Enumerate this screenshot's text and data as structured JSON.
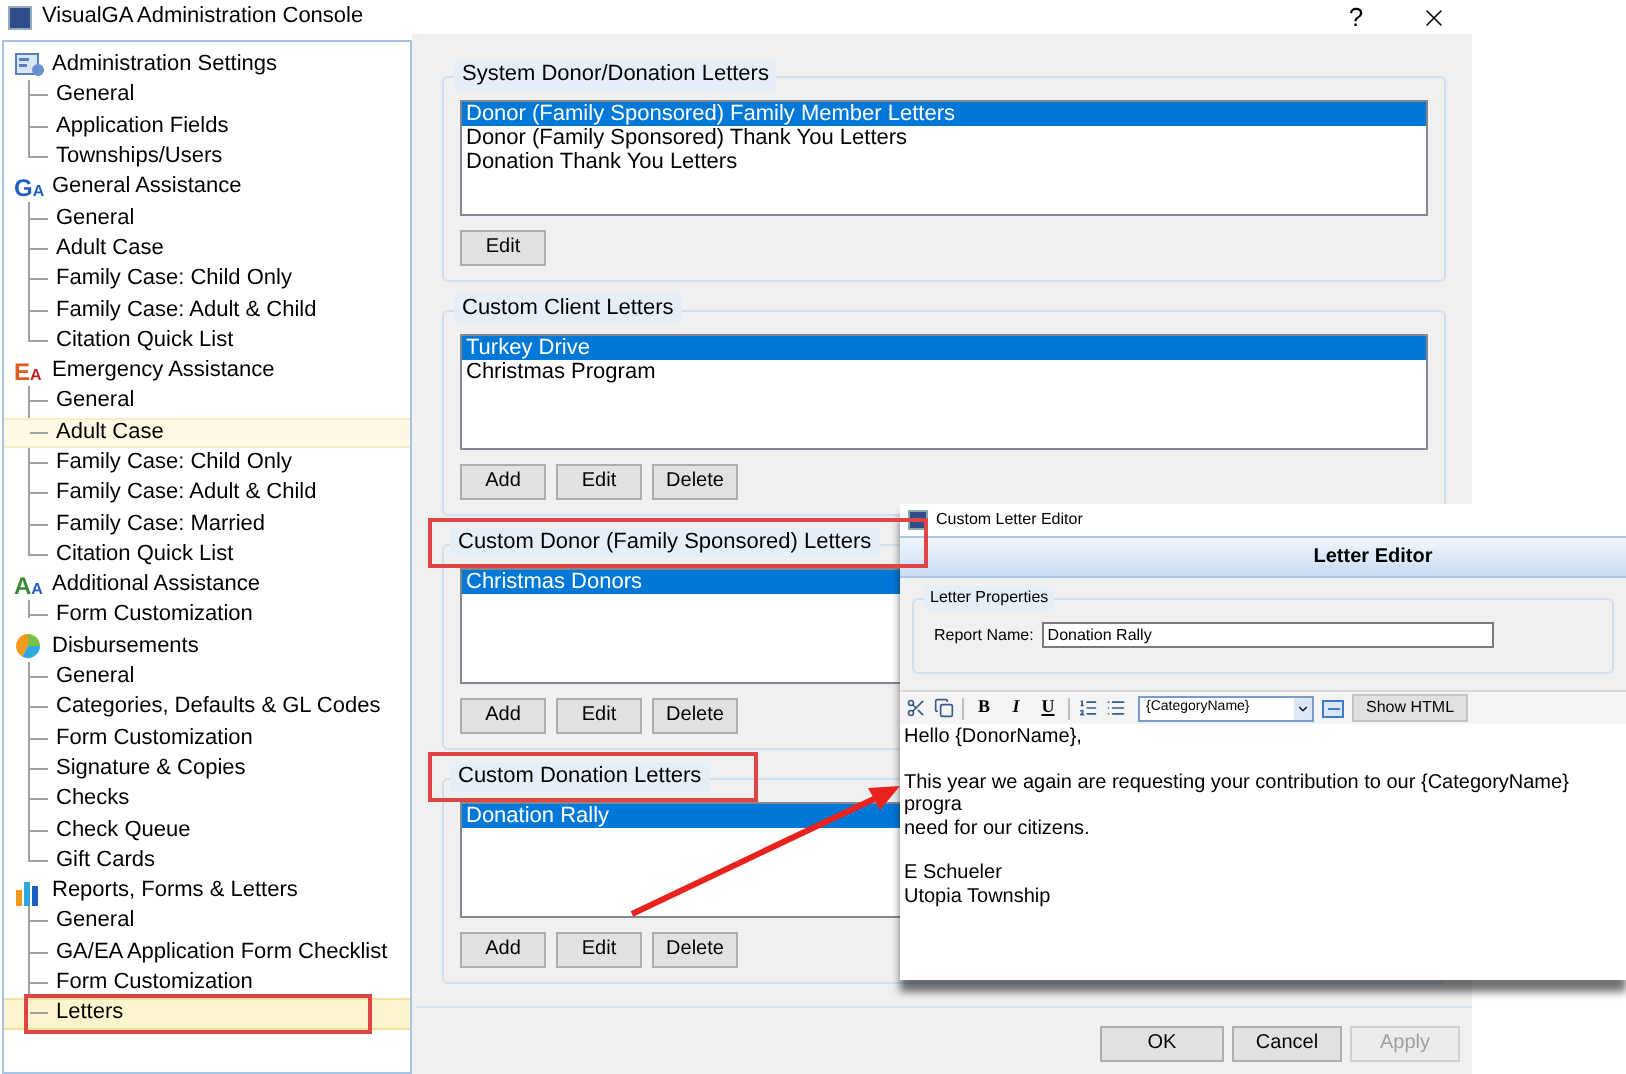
{
  "window": {
    "title": "VisualGA Administration Console",
    "help": "?"
  },
  "sidebar": {
    "items": [
      {
        "label": "Administration Settings",
        "kind": "settings",
        "children": [
          {
            "label": "General",
            "selected": false,
            "hovered": false
          },
          {
            "label": "Application Fields",
            "selected": false,
            "hovered": false
          },
          {
            "label": "Townships/Users",
            "selected": false,
            "hovered": false
          }
        ]
      },
      {
        "label": "General Assistance",
        "kind": "ga",
        "badge": [
          "G",
          "A"
        ],
        "children": [
          {
            "label": "General",
            "selected": false,
            "hovered": false
          },
          {
            "label": "Adult Case",
            "selected": false,
            "hovered": false
          },
          {
            "label": "Family Case: Child Only",
            "selected": false,
            "hovered": false
          },
          {
            "label": "Family Case: Adult & Child",
            "selected": false,
            "hovered": false
          },
          {
            "label": "Citation Quick List",
            "selected": false,
            "hovered": false
          }
        ]
      },
      {
        "label": "Emergency Assistance",
        "kind": "ea",
        "badge": [
          "E",
          "A"
        ],
        "children": [
          {
            "label": "General",
            "selected": false,
            "hovered": false
          },
          {
            "label": "Adult Case",
            "selected": false,
            "hovered": true
          },
          {
            "label": "Family Case: Child Only",
            "selected": false,
            "hovered": false
          },
          {
            "label": "Family Case: Adult & Child",
            "selected": false,
            "hovered": false
          },
          {
            "label": "Family Case: Married",
            "selected": false,
            "hovered": false
          },
          {
            "label": "Citation Quick List",
            "selected": false,
            "hovered": false
          }
        ]
      },
      {
        "label": "Additional Assistance",
        "kind": "aa",
        "badge": [
          "A",
          "A"
        ],
        "children": [
          {
            "label": "Form Customization",
            "selected": false,
            "hovered": false
          }
        ]
      },
      {
        "label": "Disbursements",
        "kind": "pie",
        "children": [
          {
            "label": "General",
            "selected": false,
            "hovered": false
          },
          {
            "label": "Categories, Defaults & GL Codes",
            "selected": false,
            "hovered": false
          },
          {
            "label": "Form Customization",
            "selected": false,
            "hovered": false
          },
          {
            "label": "Signature & Copies",
            "selected": false,
            "hovered": false
          },
          {
            "label": "Checks",
            "selected": false,
            "hovered": false
          },
          {
            "label": "Check Queue",
            "selected": false,
            "hovered": false
          },
          {
            "label": "Gift Cards",
            "selected": false,
            "hovered": false
          }
        ]
      },
      {
        "label": "Reports, Forms & Letters",
        "kind": "bars",
        "children": [
          {
            "label": "General",
            "selected": false,
            "hovered": false
          },
          {
            "label": "GA/EA Application Form Checklist",
            "selected": false,
            "hovered": false
          },
          {
            "label": "Form Customization",
            "selected": false,
            "hovered": false
          },
          {
            "label": "Letters",
            "selected": true,
            "annotated": true
          }
        ]
      }
    ]
  },
  "groups": [
    {
      "title": "System Donor/Donation Letters",
      "annotated": false,
      "items": [
        {
          "label": "Donor (Family Sponsored) Family Member Letters",
          "selected": true
        },
        {
          "label": "Donor (Family Sponsored) Thank You Letters",
          "selected": false
        },
        {
          "label": "Donation Thank You Letters",
          "selected": false
        }
      ],
      "buttons": [
        "Edit"
      ]
    },
    {
      "title": "Custom Client Letters",
      "annotated": false,
      "items": [
        {
          "label": "Turkey Drive",
          "selected": true
        },
        {
          "label": "Christmas Program",
          "selected": false
        }
      ],
      "buttons": [
        "Add",
        "Edit",
        "Delete"
      ]
    },
    {
      "title": "Custom Donor (Family Sponsored) Letters",
      "annotated": true,
      "items": [
        {
          "label": "Christmas Donors",
          "selected": true
        }
      ],
      "buttons": [
        "Add",
        "Edit",
        "Delete"
      ]
    },
    {
      "title": "Custom Donation Letters",
      "annotated": true,
      "items": [
        {
          "label": "Donation Rally",
          "selected": true
        }
      ],
      "buttons": [
        "Add",
        "Edit",
        "Delete"
      ]
    }
  ],
  "footer_buttons": [
    {
      "label": "OK",
      "disabled": false
    },
    {
      "label": "Cancel",
      "disabled": false
    },
    {
      "label": "Apply",
      "disabled": true
    }
  ],
  "editor": {
    "title": "Custom Letter Editor",
    "header": "Letter Editor",
    "properties_title": "Letter Properties",
    "report_name_label": "Report Name:",
    "report_name": "Donation Rally",
    "toolbar": {
      "format_buttons": [
        {
          "label": "B",
          "kind": "bold"
        },
        {
          "label": "I",
          "kind": "italic"
        },
        {
          "label": "U",
          "kind": "underline"
        }
      ],
      "field_value": "{CategoryName}",
      "show_html": "Show HTML"
    },
    "body": [
      [
        "Hello {DonorName},"
      ],
      [
        "This year we again are requesting your contribution to our {CategoryName} progra",
        "need for our citizens."
      ],
      [
        "E Schueler",
        "Utopia Township"
      ]
    ]
  }
}
